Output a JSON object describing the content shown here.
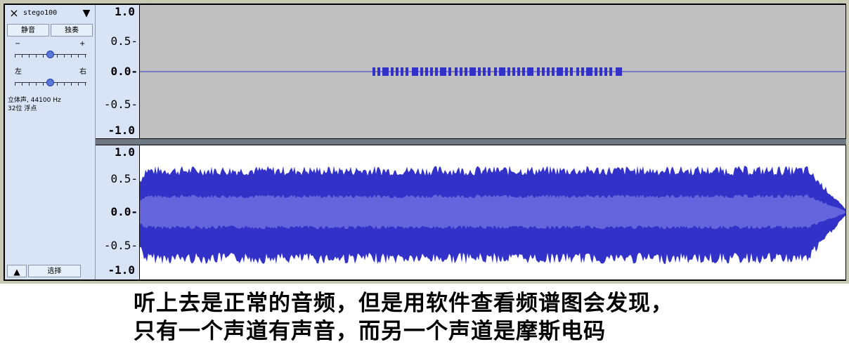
{
  "track": {
    "close_icon": "×",
    "name": "stego100",
    "menu_icon": "▼",
    "mute_label": "静音",
    "solo_label": "独奏",
    "gain": {
      "minus": "−",
      "plus": "+",
      "level": 0.5
    },
    "pan": {
      "left": "左",
      "right": "右",
      "level": 0.5
    },
    "format_line1": "立体声, 44100 Hz",
    "format_line2": "32位 浮点",
    "collapse_icon": "▲",
    "select_label": "选择"
  },
  "ruler_top": {
    "t0": "1.0",
    "t1": "0.5-",
    "t2": "0.0-",
    "t3": "-0.5-",
    "t4": "-1.0"
  },
  "ruler_bottom": {
    "t0": "1.0",
    "t1": "0.5-",
    "t2": "0.0-",
    "t3": "-0.5-",
    "t4": "-1.0"
  },
  "colors": {
    "wave_dark": "#3232c8",
    "wave_light": "#6464dc",
    "top_bg": "#c0c0c0",
    "panel": "#d8e4f6"
  },
  "caption": {
    "line1": "听上去是正常的音频，但是用软件查看频谱图会发现，",
    "line2": "只有一个声道有声音，而另一个声道是摩斯电码"
  }
}
